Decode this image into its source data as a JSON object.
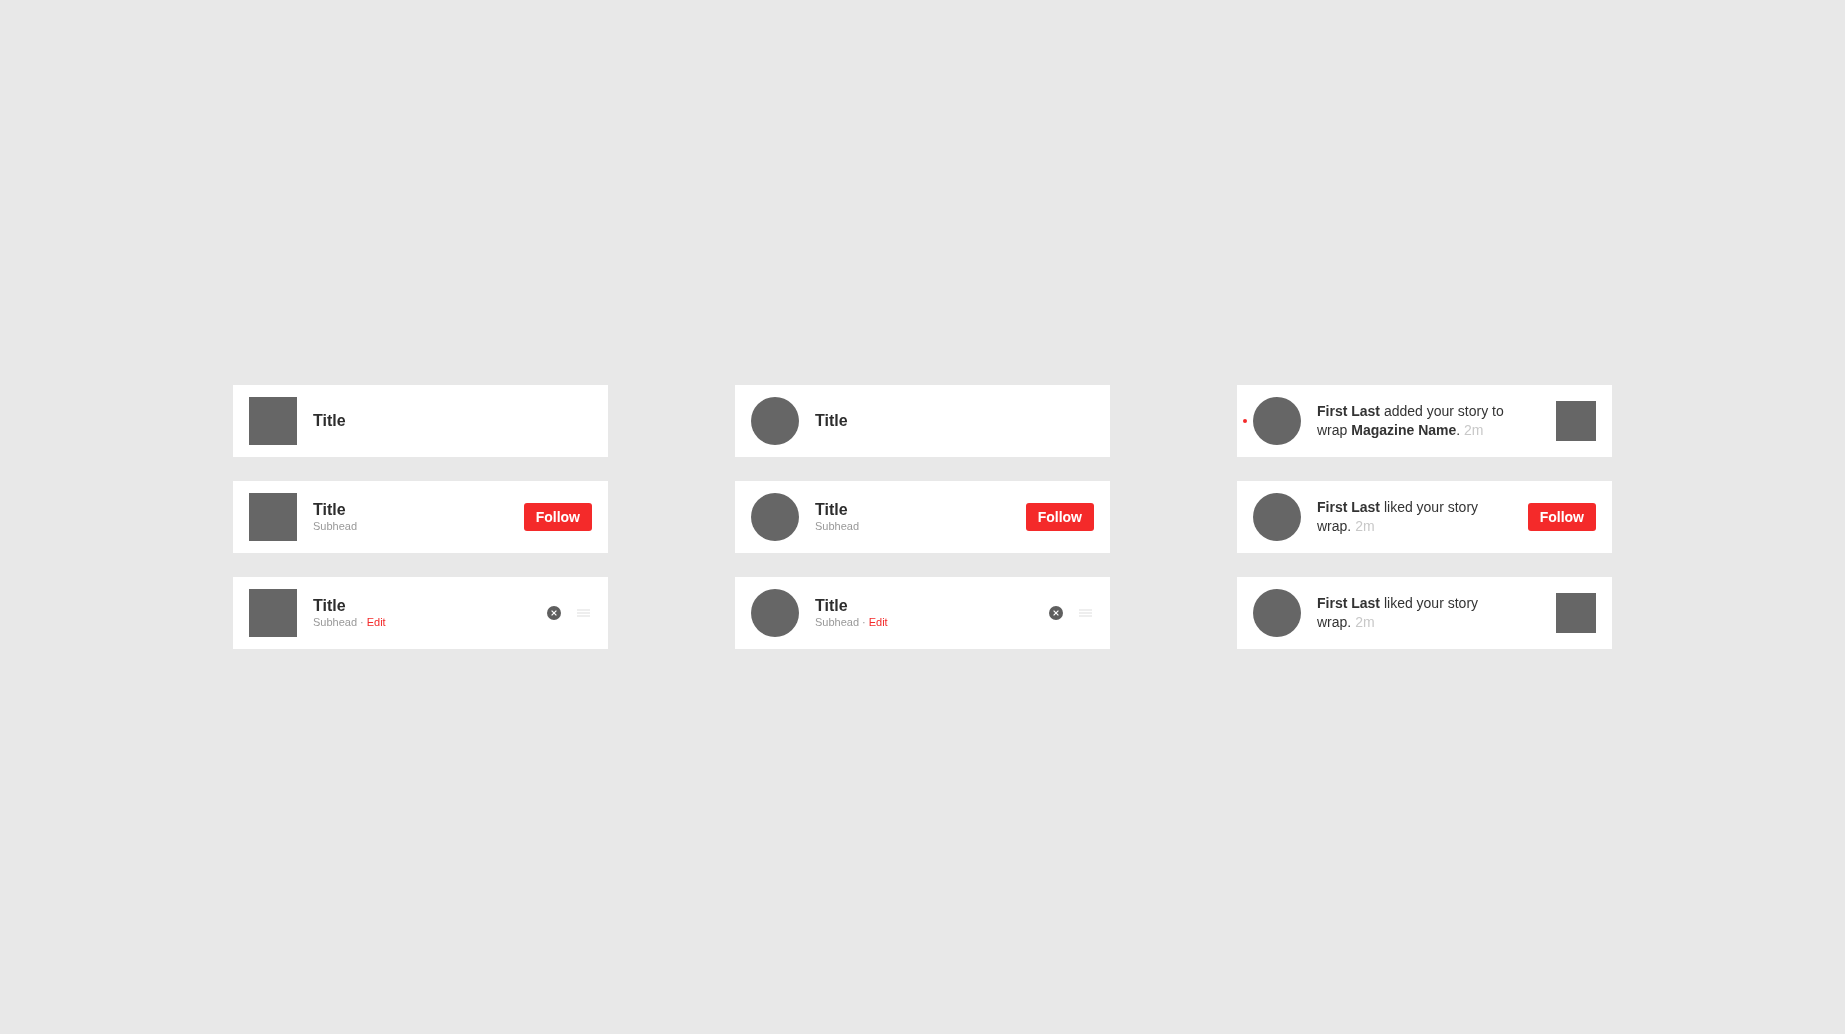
{
  "columns": [
    {
      "kind": "square",
      "items": [
        {
          "kind": "title",
          "title": "Title"
        },
        {
          "kind": "follow",
          "title": "Title",
          "subhead": "Subhead",
          "button": "Follow"
        },
        {
          "kind": "editable",
          "title": "Title",
          "subhead": "Subhead",
          "separator": "·",
          "link": "Edit"
        }
      ]
    },
    {
      "kind": "circle",
      "items": [
        {
          "kind": "title",
          "title": "Title"
        },
        {
          "kind": "follow",
          "title": "Title",
          "subhead": "Subhead",
          "button": "Follow"
        },
        {
          "kind": "editable",
          "title": "Title",
          "subhead": "Subhead",
          "separator": "·",
          "link": "Edit"
        }
      ]
    },
    {
      "kind": "circle",
      "items": [
        {
          "kind": "notification",
          "unread": true,
          "message": "**First Last** added your story to wrap **Magazine Name**.",
          "time": "2m",
          "action": {
            "kind": "thumbnail"
          }
        },
        {
          "kind": "notification",
          "unread": false,
          "message": "**First Last** liked your story wrap.",
          "time": "2m",
          "action": {
            "kind": "follow",
            "label": "Follow"
          }
        },
        {
          "kind": "notification",
          "unread": false,
          "message": "**First Last** liked your story wrap.",
          "time": "2m",
          "action": {
            "kind": "thumbnail"
          }
        }
      ]
    }
  ]
}
